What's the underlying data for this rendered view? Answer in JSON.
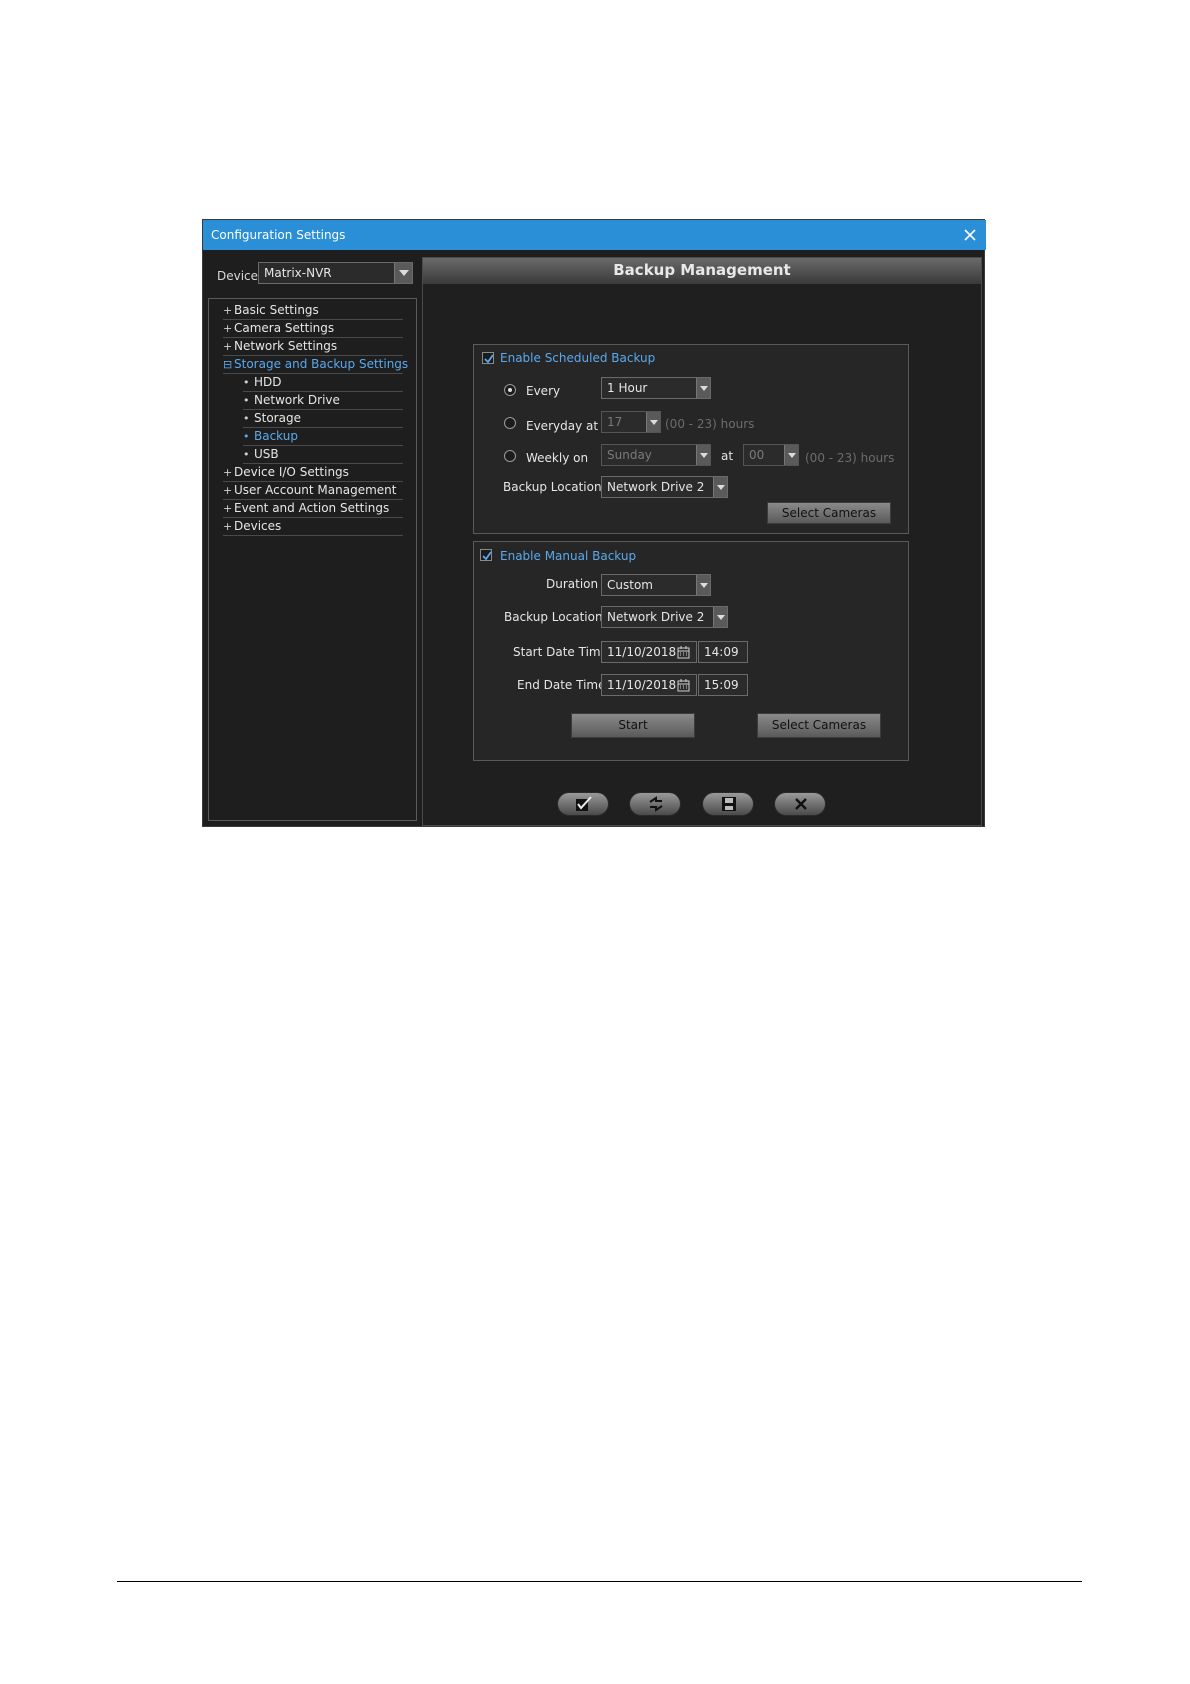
{
  "window": {
    "title": "Configuration Settings"
  },
  "sidebar": {
    "device_label": "Device",
    "device_value": "Matrix-NVR",
    "tree": [
      {
        "marker": "+",
        "label": "Basic Settings"
      },
      {
        "marker": "+",
        "label": "Camera Settings"
      },
      {
        "marker": "+",
        "label": "Network Settings"
      },
      {
        "marker": "⊟",
        "label": "Storage and Backup Settings",
        "active": true
      },
      {
        "marker": "•",
        "label": "HDD"
      },
      {
        "marker": "•",
        "label": "Network Drive"
      },
      {
        "marker": "•",
        "label": "Storage"
      },
      {
        "marker": "•",
        "label": "Backup",
        "active": true
      },
      {
        "marker": "•",
        "label": "USB"
      },
      {
        "marker": "+",
        "label": "Device I/O Settings"
      },
      {
        "marker": "+",
        "label": "User Account Management"
      },
      {
        "marker": "+",
        "label": "Event and Action Settings"
      },
      {
        "marker": "+",
        "label": "Devices"
      }
    ]
  },
  "main": {
    "title": "Backup Management",
    "scheduled": {
      "enable_label": "Enable Scheduled Backup",
      "enabled": true,
      "every_label": "Every",
      "every_value": "1 Hour",
      "everyday_label": "Everyday at",
      "everyday_value": "17",
      "everyday_hint": "(00 - 23) hours",
      "weekly_label": "Weekly on",
      "weekly_value": "Sunday",
      "at_label": "at",
      "at_value": "00",
      "weekly_hint": "(00 - 23) hours",
      "location_label": "Backup Location",
      "location_value": "Network Drive 2",
      "select_cameras_label": "Select Cameras"
    },
    "manual": {
      "enable_label": "Enable Manual Backup",
      "enabled": true,
      "duration_label": "Duration",
      "duration_value": "Custom",
      "location_label": "Backup Location",
      "location_value": "Network Drive 2",
      "start_label": "Start Date Time",
      "start_date": "11/10/2018",
      "start_time": "14:09",
      "end_label": "End Date Time",
      "end_date": "11/10/2018",
      "end_time": "15:09",
      "start_button_label": "Start",
      "select_cameras_label": "Select Cameras"
    },
    "toolbar": {
      "icons": [
        "apply-icon",
        "refresh-icon",
        "save-icon",
        "close-icon"
      ]
    }
  },
  "colors": {
    "titlebar": "#2a8fd6",
    "accent": "#5aa9ee",
    "background": "#1e1e1e"
  }
}
